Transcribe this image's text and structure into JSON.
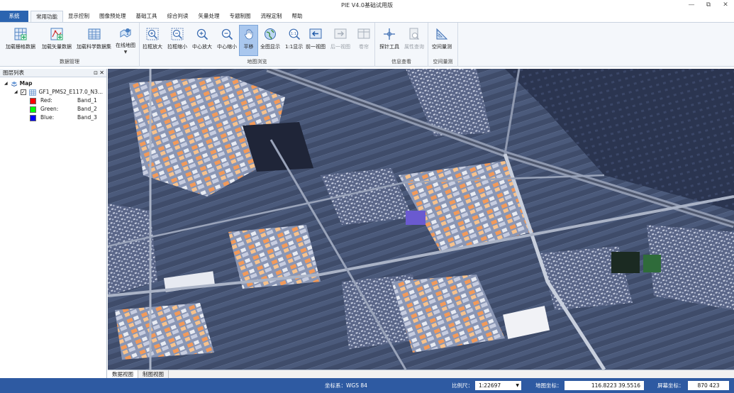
{
  "window": {
    "title": "PIE V4.0基础试用版",
    "minimize": "—",
    "restore": "⧉",
    "close": "✕"
  },
  "menu": {
    "system": "系统",
    "tabs": [
      "常用功能",
      "显示控制",
      "图像预处理",
      "基础工具",
      "综合判读",
      "矢量处理",
      "专题制图",
      "流程定制",
      "帮助"
    ]
  },
  "ribbon": {
    "groups": {
      "data": "数据管理",
      "browse": "地图浏览",
      "info": "信息查看",
      "measure": "空间量测"
    },
    "buttons": {
      "add_raster": "加载栅格数据",
      "add_vector": "加载矢量数据",
      "add_science": "加载科学数据集",
      "online_map": "在线地图",
      "zoom_in_drag": "拉框放大",
      "zoom_out_drag": "拉框缩小",
      "center_zoom_in": "中心放大",
      "center_zoom_out": "中心缩小",
      "pan": "平移",
      "full_extent": "全图显示",
      "one_to_one": "1:1显示",
      "prev_view": "前一视图",
      "next_view": "后一视图",
      "roll": "卷帘",
      "probe": "探针工具",
      "attr_query": "属性查询",
      "space_measure": "空间量测"
    }
  },
  "layers": {
    "title": "图层列表",
    "root": "Map",
    "layer_name": "GF1_PMS2_E117.0_N3...",
    "bands": [
      {
        "label": "Red:",
        "band": "Band_1",
        "color": "#ff0000"
      },
      {
        "label": "Green:",
        "band": "Band_2",
        "color": "#00ff00"
      },
      {
        "label": "Blue:",
        "band": "Band_3",
        "color": "#0000ff"
      }
    ]
  },
  "view_tabs": [
    "数据视图",
    "制图视图"
  ],
  "status": {
    "crs": "坐标系：WGS 84",
    "scale_label": "比例尺：",
    "scale_value": "1:22697",
    "map_coord_label": "地图坐标：",
    "map_coord_value": "116.8223  39.5516",
    "screen_coord_label": "屏幕坐标：",
    "screen_coord_value": "870  423"
  },
  "colors": {
    "accent": "#2b64b0",
    "status_bar": "#2e5aa2",
    "ribbon_bg": "#f4f7fb",
    "pressed": "#a9c7ee"
  }
}
